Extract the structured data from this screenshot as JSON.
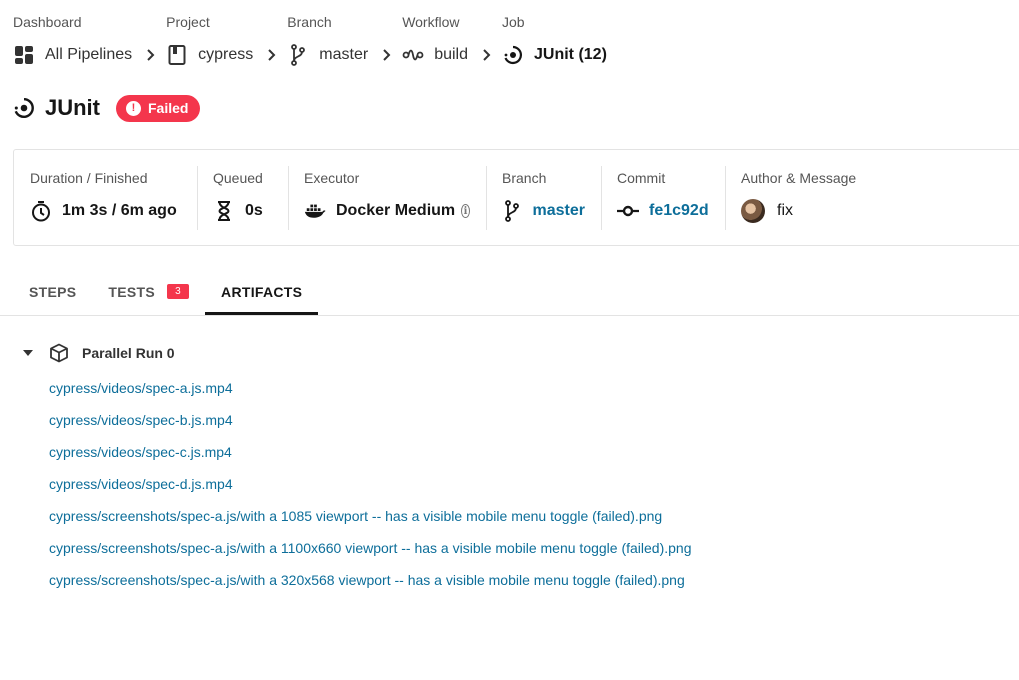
{
  "breadcrumb": [
    {
      "label": "Dashboard",
      "value": "All Pipelines",
      "icon": "dashboard-icon"
    },
    {
      "label": "Project",
      "value": "cypress",
      "icon": "project-icon"
    },
    {
      "label": "Branch",
      "value": "master",
      "icon": "branch-icon"
    },
    {
      "label": "Workflow",
      "value": "build",
      "icon": "workflow-icon"
    },
    {
      "label": "Job",
      "value": "JUnit (12)",
      "icon": "job-icon"
    }
  ],
  "job": {
    "title": "JUnit",
    "status": "Failed",
    "status_color": "#f4364c"
  },
  "details": {
    "duration": {
      "label": "Duration / Finished",
      "value": "1m 3s / 6m ago",
      "icon": "stopwatch-icon"
    },
    "queued": {
      "label": "Queued",
      "value": "0s",
      "icon": "hourglass-icon"
    },
    "executor": {
      "label": "Executor",
      "value": "Docker Medium",
      "icon": "docker-icon"
    },
    "branch": {
      "label": "Branch",
      "value": "master",
      "icon": "branch-icon"
    },
    "commit": {
      "label": "Commit",
      "value": "fe1c92d",
      "icon": "commit-icon"
    },
    "author": {
      "label": "Author & Message",
      "value": "fix",
      "icon": "avatar"
    }
  },
  "tabs": [
    {
      "label": "STEPS",
      "active": false
    },
    {
      "label": "TESTS",
      "count": "3",
      "active": false
    },
    {
      "label": "ARTIFACTS",
      "active": true
    }
  ],
  "artifacts": {
    "group_label": "Parallel Run 0",
    "files": [
      "cypress/videos/spec-a.js.mp4",
      "cypress/videos/spec-b.js.mp4",
      "cypress/videos/spec-c.js.mp4",
      "cypress/videos/spec-d.js.mp4",
      "cypress/screenshots/spec-a.js/with a 1085 viewport -- has a visible mobile menu toggle (failed).png",
      "cypress/screenshots/spec-a.js/with a 1100x660 viewport -- has a visible mobile menu toggle (failed).png",
      "cypress/screenshots/spec-a.js/with a 320x568 viewport -- has a visible mobile menu toggle (failed).png"
    ]
  },
  "colors": {
    "link": "#0d6e9a",
    "failed": "#f4364c",
    "text": "#161616",
    "muted": "#555555"
  }
}
